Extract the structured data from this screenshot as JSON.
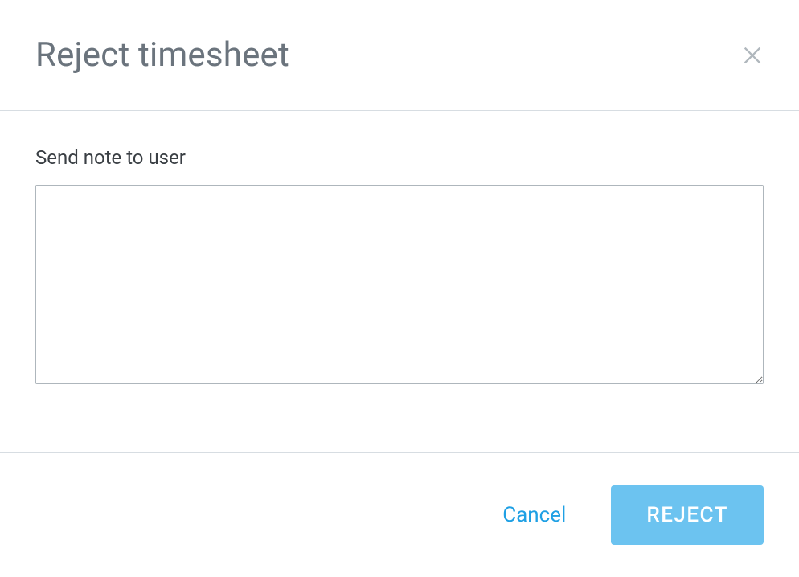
{
  "dialog": {
    "title": "Reject timesheet",
    "note_label": "Send note to user",
    "note_value": "",
    "cancel_label": "Cancel",
    "reject_label": "REJECT"
  }
}
